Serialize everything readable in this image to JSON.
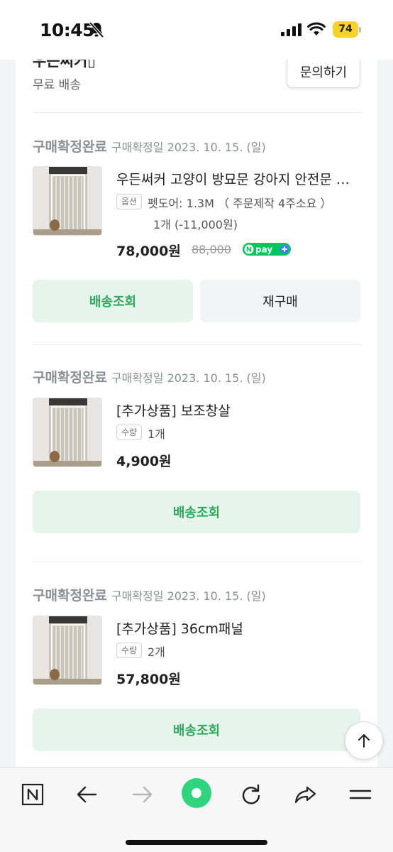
{
  "status_bar": {
    "time": "10:45",
    "battery": "74"
  },
  "seller": {
    "name": "우든써커▯",
    "shipping": "무료 배송",
    "inquiry_label": "문의하기"
  },
  "orders": [
    {
      "status": "구매확정완료",
      "date": "구매확정일 2023. 10. 15. (일)",
      "name": "우든써커 고양이 방묘문 강아지 안전문 방묘문 펫도어",
      "badge": "옵션",
      "option": "펫도어: 1.3M （ 주문제작 4주소요 ）",
      "option2": "1개 (-11,000원)",
      "price": "78,000원",
      "original_price": "88,000",
      "npay": "N pay",
      "buttons": {
        "track": "배송조회",
        "rebuy": "재구매"
      }
    },
    {
      "status": "구매확정완료",
      "date": "구매확정일 2023. 10. 15. (일)",
      "name": "[추가상품] 보조창살",
      "badge": "수량",
      "option": "1개",
      "price": "4,900원",
      "buttons": {
        "track": "배송조회"
      }
    },
    {
      "status": "구매확정완료",
      "date": "구매확정일 2023. 10. 15. (일)",
      "name": "[추가상품] 36cm패널",
      "badge": "수량",
      "option": "2개",
      "price": "57,800원",
      "buttons": {
        "track": "배송조회"
      }
    }
  ],
  "toolbar": {
    "items": [
      "n-logo-icon",
      "back-arrow-icon",
      "forward-arrow-icon",
      "home-circle-icon",
      "refresh-icon",
      "share-icon",
      "menu-icon"
    ]
  },
  "colors": {
    "accent_green": "#2fa85e",
    "button_green_bg": "#e6f5ec",
    "npay_green": "#03c75a",
    "npay_blue": "#3b82f6",
    "battery_yellow": "#f5d329"
  }
}
